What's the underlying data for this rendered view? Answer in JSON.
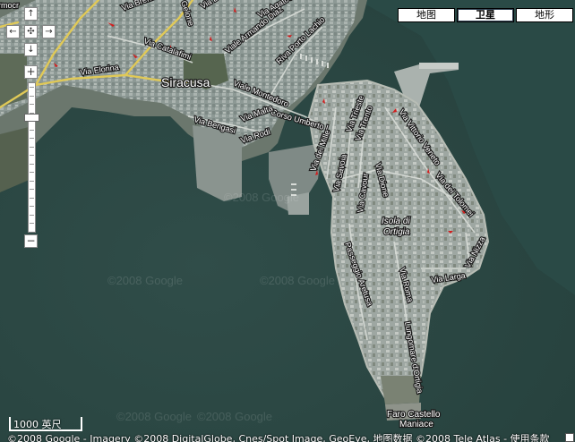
{
  "map": {
    "city_label": "Siracusa",
    "island_label_line1": "Isola di",
    "island_label_line2": "Ortigia",
    "castle_label_line1": "Faro Castello",
    "castle_label_line2": "Maniace",
    "street_labels": [
      "Via Elorina",
      "Via Brenta",
      "Gelone",
      "Via Ba",
      "Via Agatocl",
      "Viale Armando Diaz",
      "Riva Porto Lachio",
      "Via Catalafimi",
      "Viale Montedoro",
      "Corso Umberto I",
      "Via Malta",
      "Via Bengasi",
      "Via Rodi",
      "Via Vittorio Veneto",
      "Via dei Mille",
      "Via Trieste",
      "Via Trento",
      "Via Savoia",
      "Via Cavour",
      "Via Dione",
      "Via dei Tolomei",
      "Via Nizza",
      "Via Larga",
      "Via Roma",
      "Passeggio Aretusa",
      "Lungomare d'Ortigia",
      "rmocr"
    ]
  },
  "controls": {
    "pan_up": "↑",
    "pan_left": "←",
    "pan_center": "✣",
    "pan_right": "→",
    "pan_down": "↓",
    "zoom_in": "+",
    "zoom_out": "−",
    "zoom_level_fraction": 0.78
  },
  "map_types": [
    {
      "label": "地图",
      "active": false
    },
    {
      "label": "卫星",
      "active": true
    },
    {
      "label": "地形",
      "active": false
    }
  ],
  "scale": {
    "label": "1000 英尺"
  },
  "copyright": "©2008 Google - Imagery ©2008 DigitalGlobe, Cnes/Spot Image, GeoEye, 地图数据 ©2008 Tele Atlas - 使用条款",
  "watermark": "©2008 Google",
  "colors": {
    "sea": "#2d4a47",
    "land": "#5a6a5c",
    "urban": "#9aa6a2",
    "road_major": "#e8cf5a",
    "one_way_arrow": "#d21e1e"
  }
}
